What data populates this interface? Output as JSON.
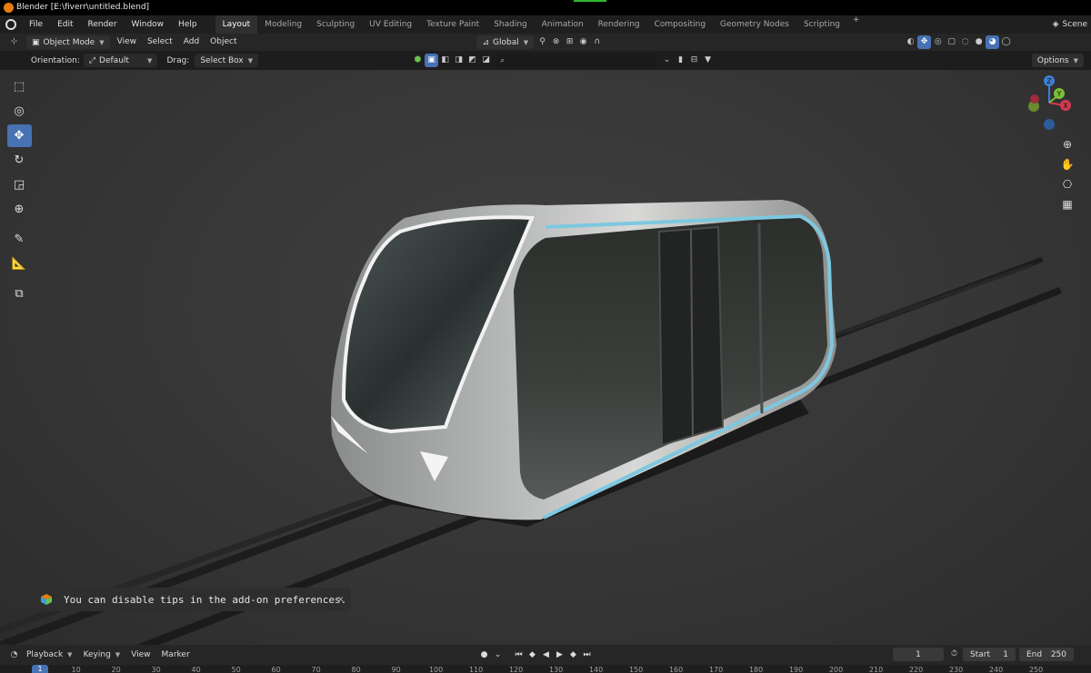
{
  "window": {
    "title": "Blender [E:\\fiverr\\untitled.blend]"
  },
  "menubar": {
    "items": [
      "File",
      "Edit",
      "Render",
      "Window",
      "Help"
    ],
    "workspaces": [
      "Layout",
      "Modeling",
      "Sculpting",
      "UV Editing",
      "Texture Paint",
      "Shading",
      "Animation",
      "Rendering",
      "Compositing",
      "Geometry Nodes",
      "Scripting"
    ],
    "active_workspace": "Layout",
    "add_workspace": "+",
    "scene_label": "Scene"
  },
  "header": {
    "mode": "Object Mode",
    "view": "View",
    "select": "Select",
    "add": "Add",
    "object": "Object",
    "transform_orientation": "Global"
  },
  "subheader": {
    "orientation_label": "Orientation:",
    "orientation_value": "Default",
    "drag_label": "Drag:",
    "drag_value": "Select Box",
    "search_placeholder": "",
    "options": "Options"
  },
  "toolbar": {
    "tools": [
      "select-box",
      "cursor",
      "move",
      "rotate",
      "scale",
      "transform",
      "annotate",
      "measure",
      "add-cube"
    ],
    "active_tool": "move"
  },
  "gizmo": {
    "z": "Z",
    "y": "Y",
    "x": "X"
  },
  "tip": {
    "text": "You can disable tips in the add-on preferences.",
    "close": "✕"
  },
  "timeline": {
    "playback": "Playback",
    "keying": "Keying",
    "view": "View",
    "marker": "Marker",
    "current_frame": "1",
    "start_label": "Start",
    "start_value": "1",
    "end_label": "End",
    "end_value": "250",
    "ruler_current": "1",
    "ruler_ticks": [
      "10",
      "20",
      "30",
      "40",
      "50",
      "60",
      "70",
      "80",
      "90",
      "100",
      "110",
      "120",
      "130",
      "140",
      "150",
      "160",
      "170",
      "180",
      "190",
      "200",
      "210",
      "220",
      "230",
      "240",
      "250"
    ]
  },
  "colors": {
    "accent": "#4772b3",
    "trim_cyan": "#7cc8e0",
    "blender_orange": "#e87d0d"
  }
}
